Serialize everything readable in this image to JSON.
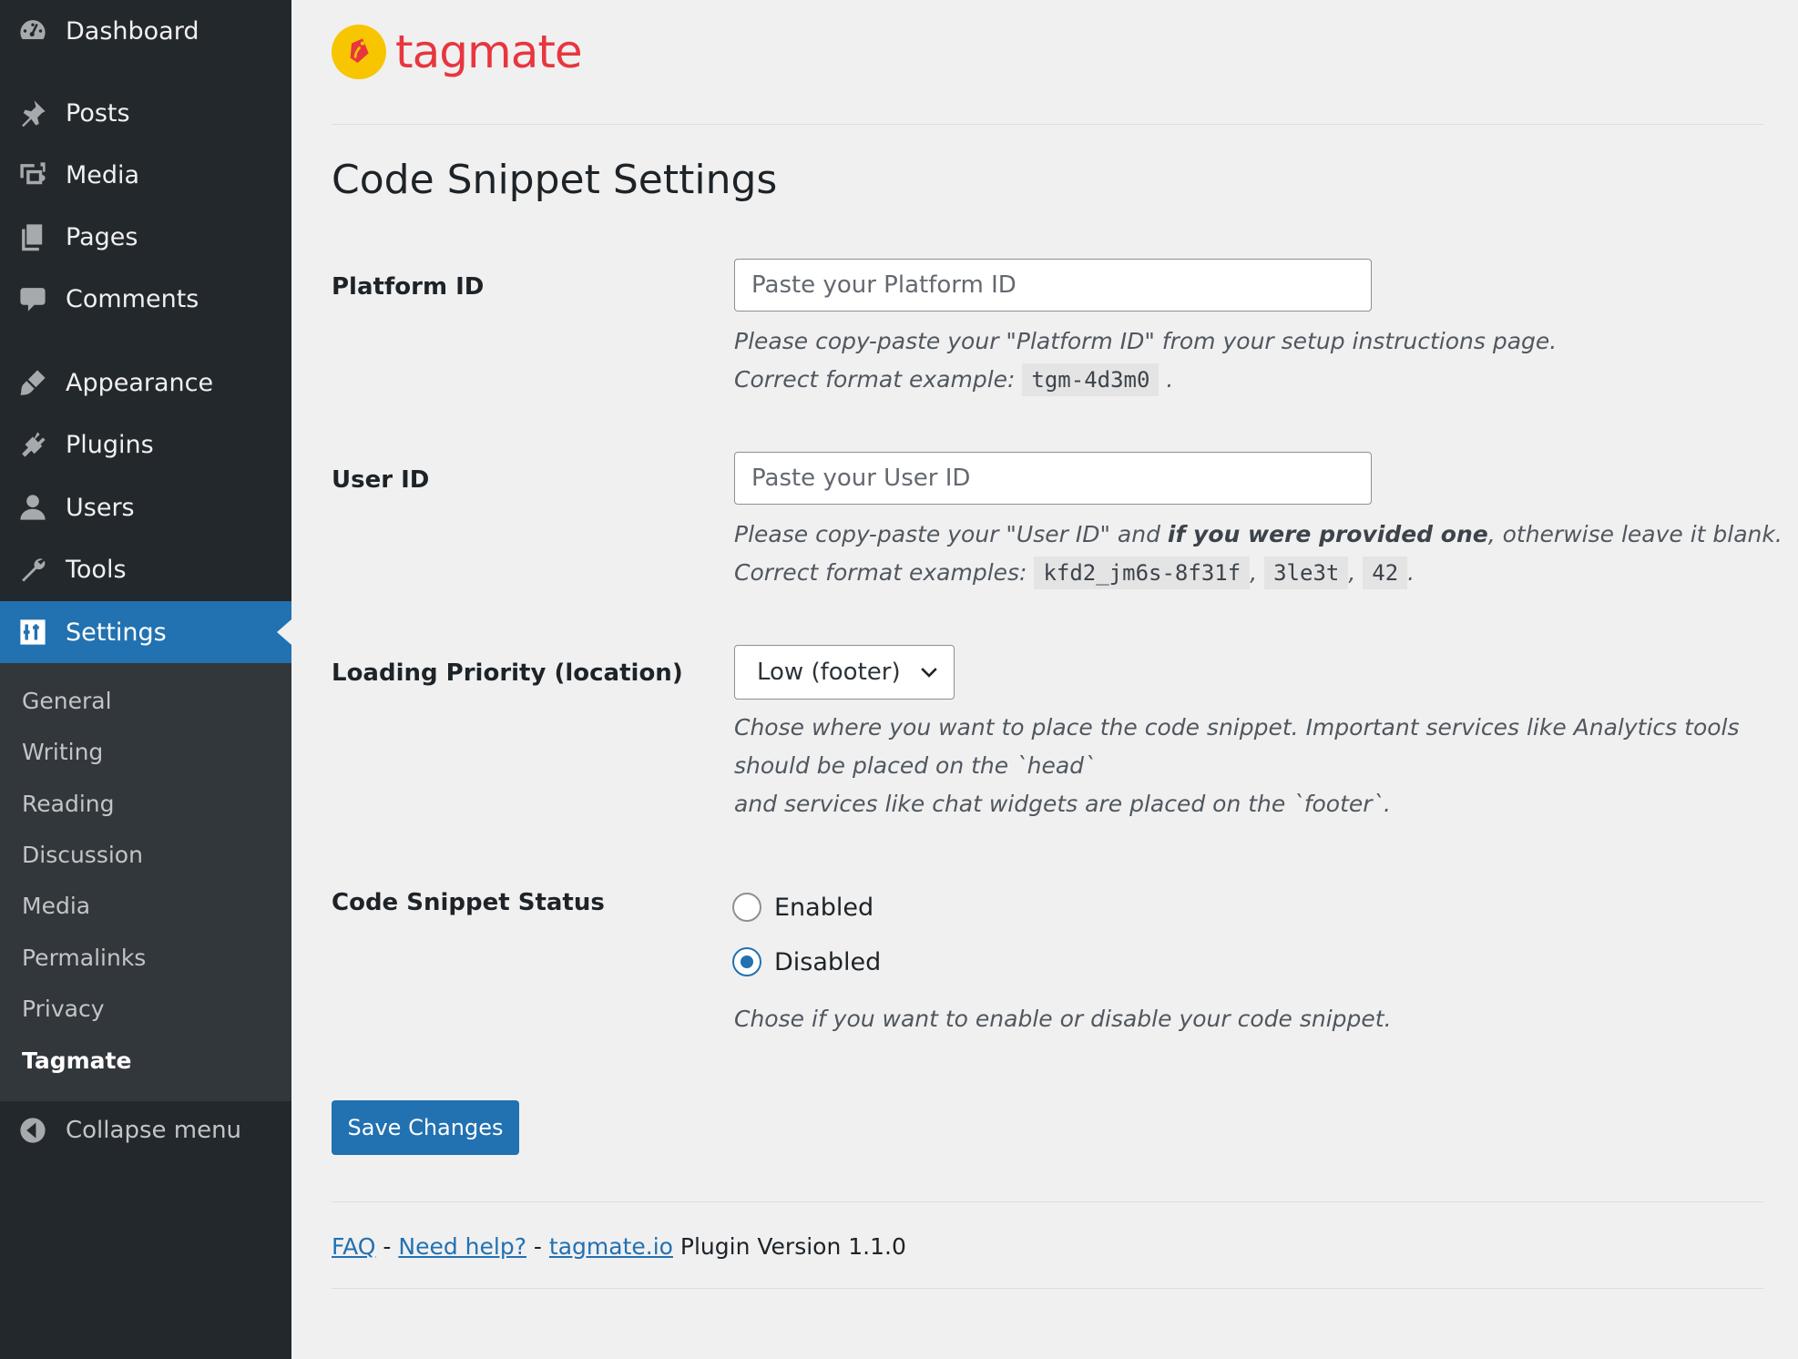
{
  "sidebar": {
    "items": [
      {
        "label": "Dashboard",
        "icon": "dashboard-icon"
      },
      {
        "label": "Posts",
        "icon": "pin-icon"
      },
      {
        "label": "Media",
        "icon": "media-icon"
      },
      {
        "label": "Pages",
        "icon": "pages-icon"
      },
      {
        "label": "Comments",
        "icon": "comment-icon"
      },
      {
        "label": "Appearance",
        "icon": "brush-icon"
      },
      {
        "label": "Plugins",
        "icon": "plugin-icon"
      },
      {
        "label": "Users",
        "icon": "user-icon"
      },
      {
        "label": "Tools",
        "icon": "wrench-icon"
      },
      {
        "label": "Settings",
        "icon": "settings-icon"
      }
    ],
    "submenu": [
      "General",
      "Writing",
      "Reading",
      "Discussion",
      "Media",
      "Permalinks",
      "Privacy",
      "Tagmate"
    ],
    "collapse_label": "Collapse menu"
  },
  "brand": {
    "name": "tagmate",
    "color": "#e8363f",
    "mark_color": "#f7c600"
  },
  "page": {
    "title": "Code Snippet Settings"
  },
  "fields": {
    "platform_id": {
      "label": "Platform ID",
      "placeholder": "Paste your Platform ID",
      "value": "",
      "desc_line1": "Please copy-paste your \"Platform ID\" from your setup instructions page.",
      "desc_prefix": "Correct format example:",
      "example": "tgm-4d3m0",
      "desc_suffix": "."
    },
    "user_id": {
      "label": "User ID",
      "placeholder": "Paste your User ID",
      "value": "",
      "desc_part1": "Please copy-paste your \"User ID\" and ",
      "desc_bold": "if you were provided one",
      "desc_part2": ", otherwise leave it blank.",
      "desc_prefix": "Correct format examples:",
      "examples": [
        "kfd2_jm6s-8f31f",
        "3le3t",
        "42"
      ],
      "sep": ",",
      "desc_suffix": "."
    },
    "loading_priority": {
      "label": "Loading Priority (location)",
      "selected": "Low (footer)",
      "desc_line1": "Chose where you want to place the code snippet. Important services like Analytics tools",
      "desc_line2": "should be placed on the `head`",
      "desc_line3": "and services like chat widgets are placed on the `footer`."
    },
    "status": {
      "label": "Code Snippet Status",
      "options": [
        {
          "label": "Enabled",
          "checked": false
        },
        {
          "label": "Disabled",
          "checked": true
        }
      ],
      "desc": "Chose if you want to enable or disable your code snippet."
    }
  },
  "actions": {
    "save_label": "Save Changes"
  },
  "footer": {
    "faq": "FAQ",
    "dash1": "-",
    "help": "Need help?",
    "dash2": "-",
    "site": "tagmate.io",
    "version_text": "Plugin Version 1.1.0"
  },
  "colors": {
    "sidebar_bg": "#23282d",
    "submenu_bg": "#32373c",
    "accent": "#2271b1",
    "page_bg": "#f0f0f1"
  }
}
